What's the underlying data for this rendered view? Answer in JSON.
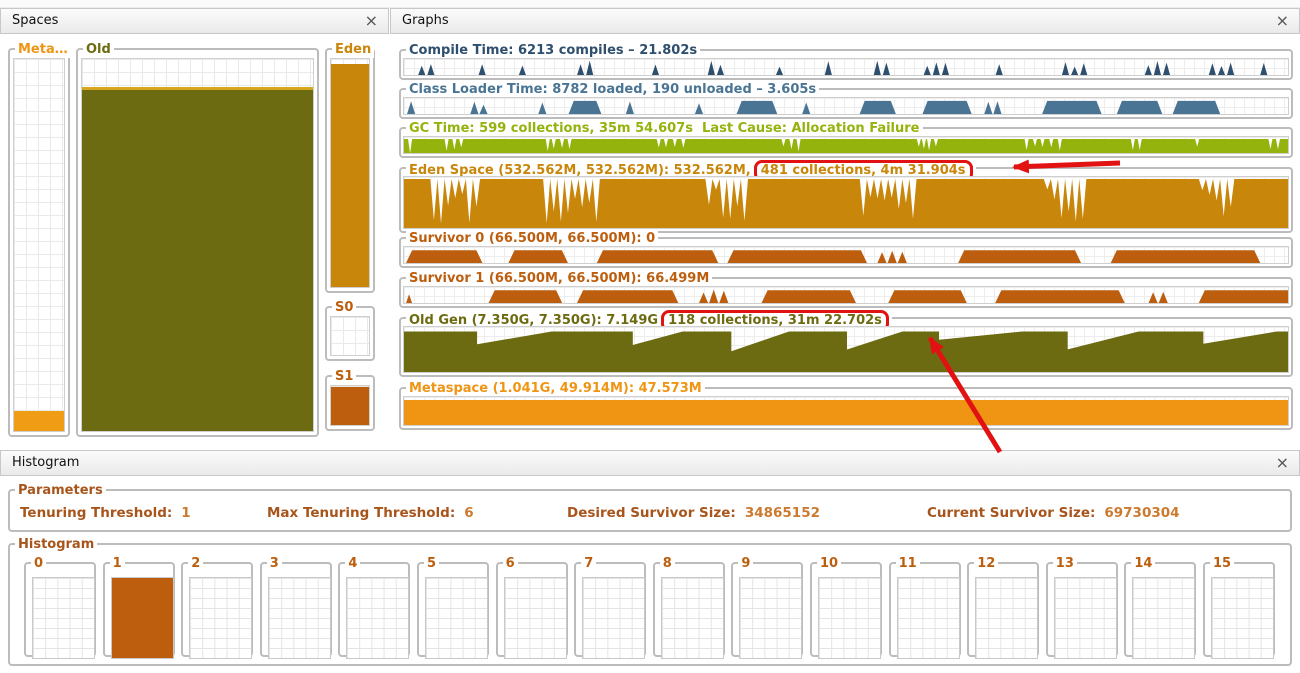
{
  "panels": {
    "spaces": {
      "title": "Spaces",
      "close": "×"
    },
    "graphs": {
      "title": "Graphs",
      "close": "×"
    },
    "histogram": {
      "title": "Histogram",
      "close": "×"
    }
  },
  "spaces": {
    "boxes": [
      {
        "id": "metaspace",
        "label": "Meta…",
        "labelColor": "#ef9513",
        "fillColor": "#f09c15",
        "fillFrom": 0.945
      },
      {
        "id": "old",
        "label": "Old",
        "labelColor": "#6c6b11",
        "fillColor": "#6c6b11",
        "fillFrom": 0.075,
        "topLine": "#d7a81e"
      },
      {
        "id": "eden",
        "label": "Eden",
        "labelColor": "#c8860b",
        "fillColor": "#c8860b",
        "fillFrom": 0.02
      },
      {
        "id": "s0",
        "label": "S0",
        "labelColor": "#bc5e0e",
        "fillColor": null,
        "fillFrom": 1
      },
      {
        "id": "s1",
        "label": "S1",
        "labelColor": "#bc5e0e",
        "fillColor": "#bc5e0e",
        "fillFrom": 0.03
      }
    ]
  },
  "graphs": {
    "rows": [
      {
        "id": "compile-time",
        "label": "Compile Time: 6213 compiles – 21.802s",
        "highlight": "",
        "color": "#2f4f6e",
        "type": "spikes"
      },
      {
        "id": "class-loader-time",
        "label": "Class Loader Time: 8782 loaded, 190 unloaded – 3.605s",
        "highlight": "",
        "color": "#4a7494",
        "type": "blocks"
      },
      {
        "id": "gc-time",
        "label": "GC Time: 599 collections, 35m 54.607s  Last Cause: Allocation Failure",
        "highlight": "",
        "color": "#94b30d",
        "type": "icicles-thin"
      },
      {
        "id": "eden-space",
        "label": "Eden Space (532.562M, 532.562M): 532.562M,",
        "highlight": "481 collections, 4m 31.904s",
        "color": "#c8860b",
        "type": "icicles"
      },
      {
        "id": "survivor-0",
        "label": "Survivor 0 (66.500M, 66.500M): 0",
        "highlight": "",
        "color": "#bc5e0e",
        "type": "blocks-wide"
      },
      {
        "id": "survivor-1",
        "label": "Survivor 1 (66.500M, 66.500M): 66.499M",
        "highlight": "",
        "color": "#bc5e0e",
        "type": "blocks-wide2"
      },
      {
        "id": "old-gen",
        "label": "Old Gen (7.350G, 7.350G): 7.149G",
        "highlight": "118 collections, 31m 22.702s",
        "color": "#6c6b11",
        "type": "sawtooth"
      },
      {
        "id": "metaspace-graph",
        "label": "Metaspace (1.041G, 49.914M): 47.573M",
        "highlight": "",
        "color": "#ef9513",
        "type": "flat"
      }
    ]
  },
  "parameters": {
    "title": "Parameters",
    "items": [
      {
        "label": "Tenuring Threshold:",
        "value": "1"
      },
      {
        "label": "Max Tenuring Threshold:",
        "value": "6"
      },
      {
        "label": "Desired Survivor Size:",
        "value": "34865152"
      },
      {
        "label": "Current Survivor Size:",
        "value": "69730304"
      }
    ]
  },
  "histogram": {
    "title": "Histogram",
    "fillColor": "#bc5e0e",
    "ages": [
      {
        "label": "0",
        "filled": false
      },
      {
        "label": "1",
        "filled": true
      },
      {
        "label": "2",
        "filled": false
      },
      {
        "label": "3",
        "filled": false
      },
      {
        "label": "4",
        "filled": false
      },
      {
        "label": "5",
        "filled": false
      },
      {
        "label": "6",
        "filled": false
      },
      {
        "label": "7",
        "filled": false
      },
      {
        "label": "8",
        "filled": false
      },
      {
        "label": "9",
        "filled": false
      },
      {
        "label": "10",
        "filled": false
      },
      {
        "label": "11",
        "filled": false
      },
      {
        "label": "12",
        "filled": false
      },
      {
        "label": "13",
        "filled": false
      },
      {
        "label": "14",
        "filled": false
      },
      {
        "label": "15",
        "filled": false
      }
    ]
  },
  "annotations": {
    "color": "#e31212"
  }
}
